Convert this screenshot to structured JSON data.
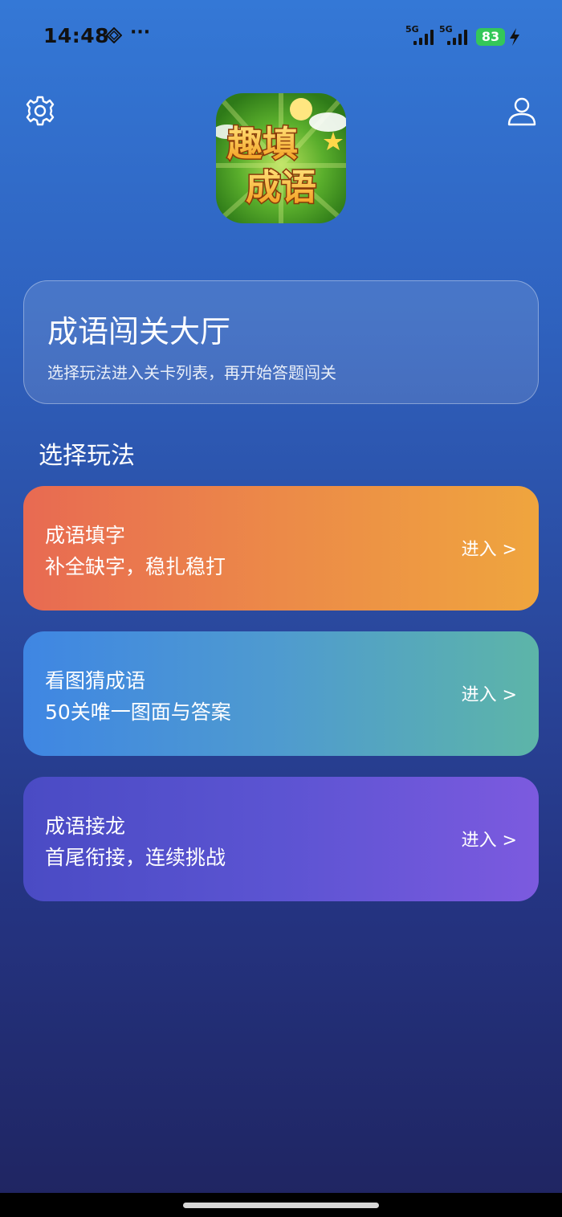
{
  "status_bar": {
    "time": "14:48",
    "more": "···",
    "signal_1_label": "5G",
    "signal_2_label": "5G",
    "battery": "83"
  },
  "header": {
    "settings_icon": "gear-icon",
    "profile_icon": "user-icon",
    "logo_line1": "趣填",
    "logo_line2": "成语"
  },
  "hall": {
    "title": "成语闯关大厅",
    "subtitle": "选择玩法进入关卡列表，再开始答题闯关"
  },
  "section_title": "选择玩法",
  "modes": [
    {
      "name": "成语填字",
      "desc": "补全缺字，稳扎稳打",
      "enter": "进入 >"
    },
    {
      "name": "看图猜成语",
      "desc": "50关唯一图面与答案",
      "enter": "进入 >"
    },
    {
      "name": "成语接龙",
      "desc": "首尾衔接，连续挑战",
      "enter": "进入 >"
    }
  ],
  "colors": {
    "mode1": "#ec8a48",
    "mode2": "#4f9bcf",
    "mode3": "#5c54d2",
    "battery": "#34c759"
  }
}
